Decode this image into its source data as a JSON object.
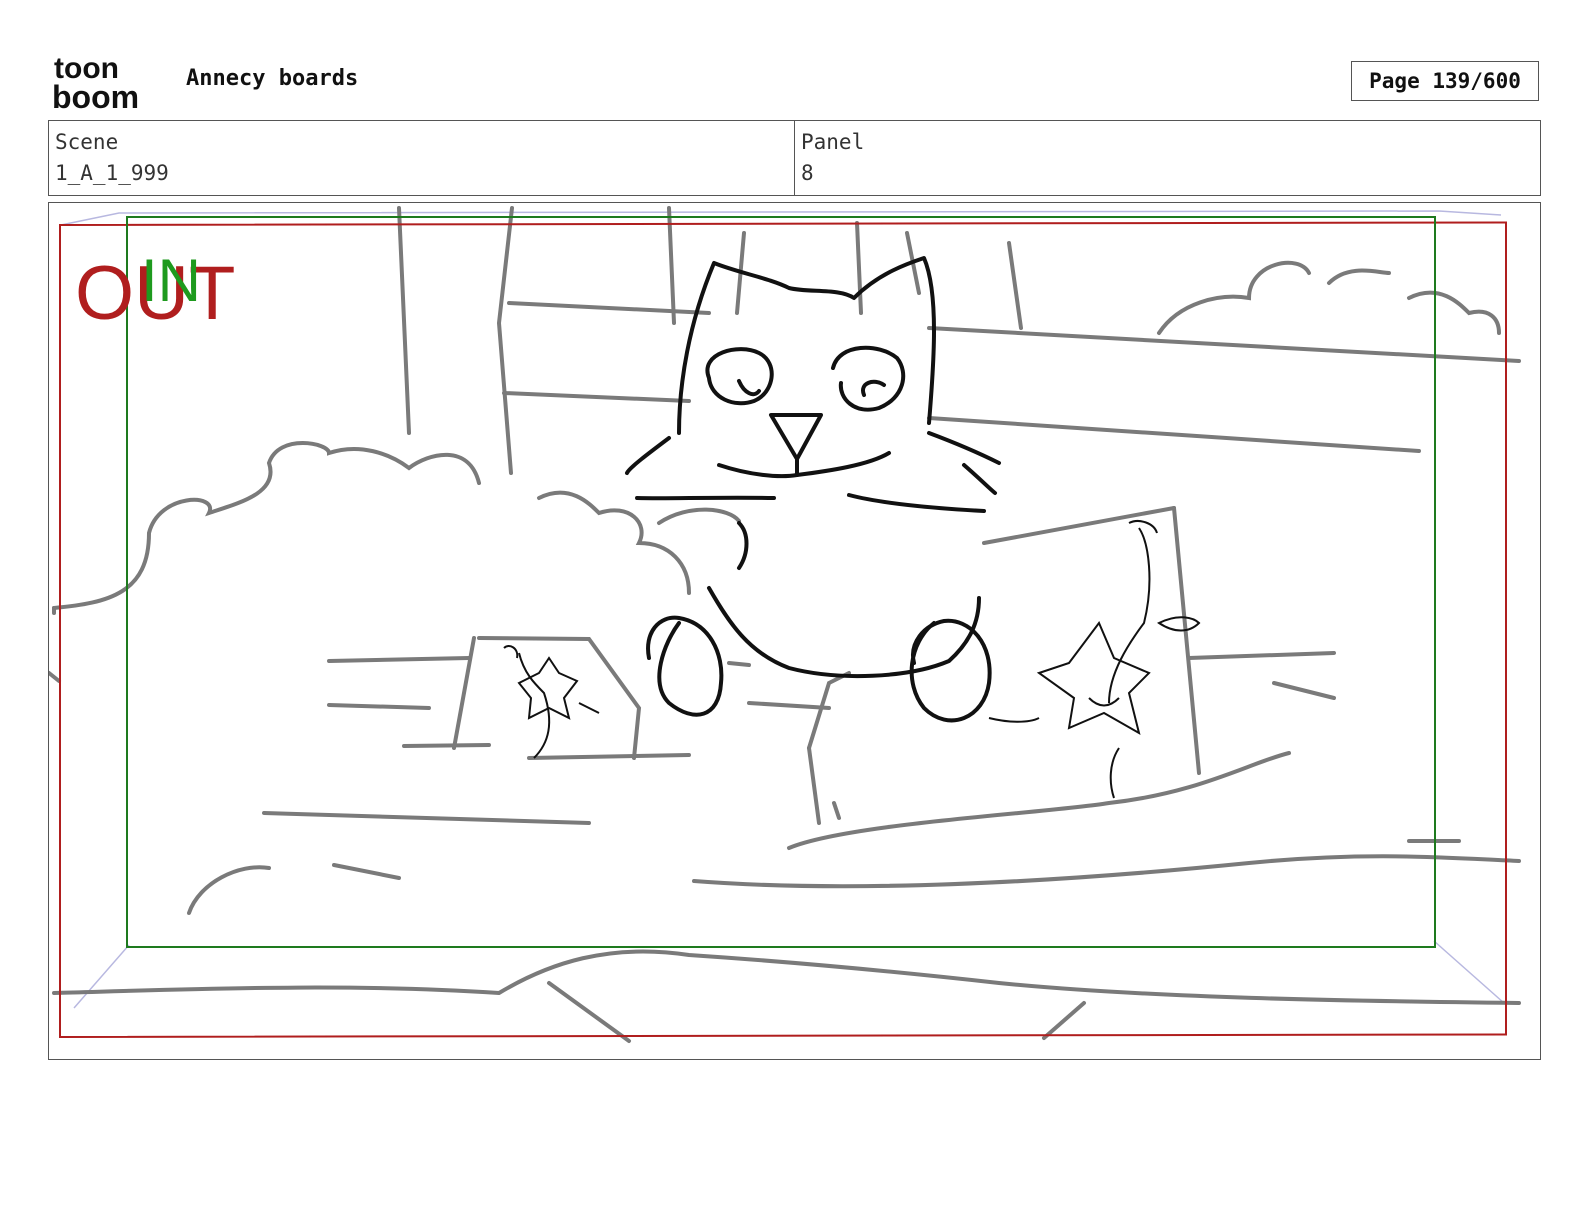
{
  "header": {
    "logo_text_top": "toon",
    "logo_text_bottom": "boom",
    "project_title": "Annecy boards",
    "page_label": "Page 139/600"
  },
  "info": {
    "scene_label": "Scene",
    "scene_value": "1_A_1_999",
    "panel_label": "Panel",
    "panel_value": "8"
  },
  "panel": {
    "out_marker": "OUT",
    "in_marker": "IN",
    "colors": {
      "out_frame": "#b01e1e",
      "in_frame": "#1e7a1e",
      "sketch_gray": "#7a7a7a",
      "sketch_black": "#111111",
      "camera_guides": "#b8b8e0"
    }
  }
}
